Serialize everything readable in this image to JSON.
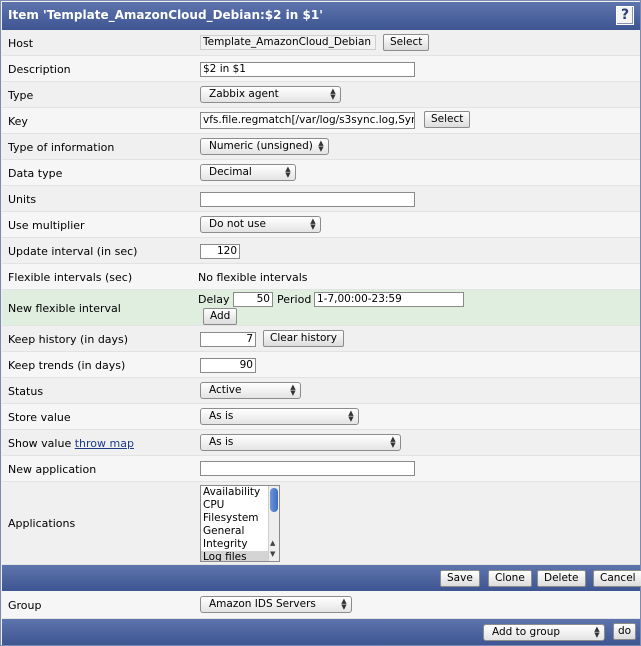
{
  "window": {
    "title": "Item 'Template_AmazonCloud_Debian:$2 in $1'",
    "help_icon": "?"
  },
  "form": {
    "host": {
      "label": "Host",
      "value": "Template_AmazonCloud_Debian",
      "button": "Select"
    },
    "description": {
      "label": "Description",
      "value": "$2 in $1"
    },
    "type": {
      "label": "Type",
      "value": "Zabbix agent"
    },
    "key": {
      "label": "Key",
      "value": "vfs.file.regmatch[/var/log/s3sync.log,Syn",
      "button": "Select"
    },
    "type_of_information": {
      "label": "Type of information",
      "value": "Numeric (unsigned)"
    },
    "data_type": {
      "label": "Data type",
      "value": "Decimal"
    },
    "units": {
      "label": "Units",
      "value": ""
    },
    "use_multiplier": {
      "label": "Use multiplier",
      "value": "Do not use"
    },
    "update_interval": {
      "label": "Update interval (in sec)",
      "value": "120"
    },
    "flexible_intervals": {
      "label": "Flexible intervals (sec)",
      "value": "No flexible intervals"
    },
    "new_flexible_interval": {
      "label": "New flexible interval",
      "delay_label": "Delay",
      "delay_value": "50",
      "period_label": "Period",
      "period_value": "1-7,00:00-23:59",
      "add_button": "Add"
    },
    "keep_history": {
      "label": "Keep history (in days)",
      "value": "7",
      "button": "Clear history"
    },
    "keep_trends": {
      "label": "Keep trends (in days)",
      "value": "90"
    },
    "status": {
      "label": "Status",
      "value": "Active"
    },
    "store_value": {
      "label": "Store value",
      "value": "As is"
    },
    "show_value": {
      "label": "Show value",
      "link": "throw map",
      "value": "As is"
    },
    "new_application": {
      "label": "New application",
      "value": ""
    },
    "applications": {
      "label": "Applications",
      "options": [
        "Availability",
        "CPU",
        "Filesystem",
        "General",
        "Integrity",
        "Log files"
      ],
      "selected": "Log files"
    }
  },
  "actions": {
    "save": "Save",
    "clone": "Clone",
    "delete": "Delete",
    "cancel": "Cancel"
  },
  "group": {
    "label": "Group",
    "value": "Amazon IDS Servers"
  },
  "footer": {
    "action_select": "Add to group",
    "do_button": "do"
  },
  "colors": {
    "header_blue": "#4a62a0",
    "highlight_row": "#dfeedf",
    "link": "#1f3b86"
  }
}
